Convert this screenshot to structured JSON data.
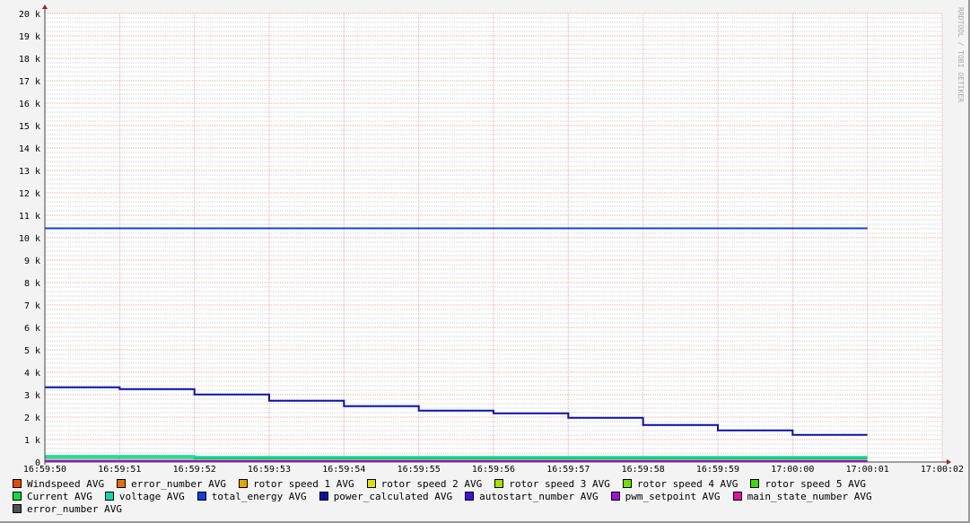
{
  "watermark": "RRDTOOL / TOBI OETIKER",
  "chart_data": {
    "type": "line",
    "title": "",
    "xlabel": "",
    "ylabel": "",
    "ylim": [
      0,
      20000
    ],
    "y_ticks": [
      "0",
      "1 k",
      "2 k",
      "3 k",
      "4 k",
      "5 k",
      "6 k",
      "7 k",
      "8 k",
      "9 k",
      "10 k",
      "11 k",
      "12 k",
      "13 k",
      "14 k",
      "15 k",
      "16 k",
      "17 k",
      "18 k",
      "19 k",
      "20 k"
    ],
    "x_ticks": [
      "16:59:50",
      "16:59:51",
      "16:59:52",
      "16:59:53",
      "16:59:54",
      "16:59:55",
      "16:59:56",
      "16:59:57",
      "16:59:58",
      "16:59:59",
      "17:00:00",
      "17:00:01",
      "17:00:02"
    ],
    "grid": true,
    "legend_placement": "bottom",
    "series": [
      {
        "name": "Windspeed AVG",
        "color": "#e64a00",
        "values": []
      },
      {
        "name": "error_number AVG",
        "color": "#e07000",
        "values": []
      },
      {
        "name": "rotor speed 1 AVG",
        "color": "#e0a800",
        "values": []
      },
      {
        "name": "rotor speed 2 AVG",
        "color": "#e0e000",
        "values": []
      },
      {
        "name": "rotor speed 3 AVG",
        "color": "#a8e000",
        "values": []
      },
      {
        "name": "rotor speed 4 AVG",
        "color": "#70e000",
        "values": []
      },
      {
        "name": "rotor speed 5 AVG",
        "color": "#40d800",
        "values": []
      },
      {
        "name": "Current AVG",
        "color": "#10d840",
        "values": [
          180,
          180,
          160,
          160,
          160,
          160,
          160,
          160,
          160,
          160,
          160
        ]
      },
      {
        "name": "voltage AVG",
        "color": "#10d8a0",
        "values": [
          270,
          270,
          230,
          230,
          230,
          230,
          230,
          230,
          230,
          230,
          230
        ]
      },
      {
        "name": "total_energy AVG",
        "color": "#1040e0",
        "values": [
          10420,
          10420,
          10420,
          10420,
          10420,
          10420,
          10420,
          10420,
          10420,
          10420,
          10420
        ]
      },
      {
        "name": "power_calculated AVG",
        "color": "#0a10a8",
        "values": [
          3330,
          3250,
          3010,
          2730,
          2490,
          2290,
          2170,
          1970,
          1650,
          1410,
          1210
        ]
      },
      {
        "name": "autostart_number AVG",
        "color": "#4010e0",
        "values": []
      },
      {
        "name": "pwm_setpoint AVG",
        "color": "#a010e0",
        "values": [
          60,
          60,
          60,
          60,
          60,
          60,
          60,
          60,
          60,
          60,
          60
        ]
      },
      {
        "name": "main_state_number AVG",
        "color": "#e010a0",
        "values": []
      },
      {
        "name": "error_number AVG",
        "color": "#505050",
        "values": []
      }
    ]
  }
}
